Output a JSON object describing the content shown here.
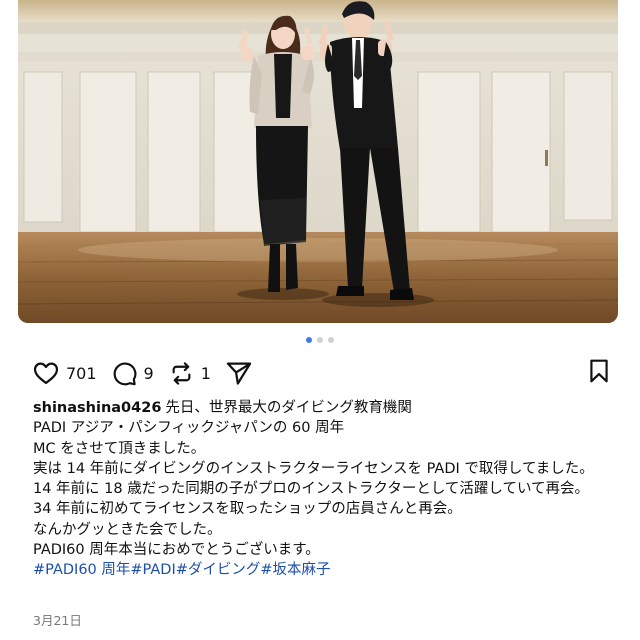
{
  "post": {
    "username": "shinashina0426",
    "caption_lines": [
      "先日、世界最大のダイビング教育機関",
      "PADI アジア・パシフィックジャパンの 60 周年",
      "MC をさせて頂きました。",
      "実は 14 年前にダイビングのインストラクターライセンスを PADI で取得してました。14 年前に 18 歳だった同期の子がプロのインストラクターとして活躍していて再会。",
      "34 年前に初めてライセンスを取ったショップの店員さんと再会。",
      "なんかグッときた会でした。",
      "PADI60 周年本当におめでとうございます。"
    ],
    "hashtags": [
      "#PADI60 周年",
      "#PADI",
      "#ダイビング",
      "#坂本麻子"
    ],
    "date": "3月21日"
  },
  "actions": {
    "likes": "701",
    "comments": "9",
    "reposts": "1"
  },
  "carousel": {
    "count": 3,
    "active": 1
  },
  "colors": {
    "accent": "#3d7be0",
    "hashtag": "#1e4fa8",
    "muted": "#777777"
  },
  "icons": [
    "heart-icon",
    "comment-icon",
    "repost-icon",
    "send-icon",
    "bookmark-icon"
  ]
}
